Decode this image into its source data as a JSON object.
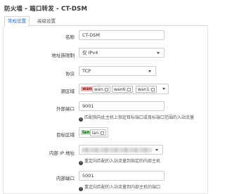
{
  "page_title": "防火墙 - 端口转发 - CT-DSM",
  "tabs": [
    {
      "label": "常规设置",
      "active": true
    },
    {
      "label": "高级设置",
      "active": false
    }
  ],
  "form": {
    "name": {
      "label": "名称",
      "value": "CT-DSM"
    },
    "address_family": {
      "label": "地址族限制",
      "value": "仅 IPv4"
    },
    "protocol": {
      "label": "协议",
      "value": "TCP"
    },
    "source_zone": {
      "label": "源区域",
      "zone": "wan",
      "devices": [
        "wan:",
        "wan6:",
        "wan1:"
      ]
    },
    "external_port": {
      "label": "外部端口",
      "value": "9001",
      "help": "匹配指向此主机上指定目标端口或目标端口范围的入站流量"
    },
    "dest_zone": {
      "label": "目标区域",
      "zone": "lan",
      "devices": [
        "lan:"
      ]
    },
    "internal_ip": {
      "label": "内部 IP 地址",
      "help": "重定向匹配的入站流量到指定的内部主机"
    },
    "internal_port": {
      "label": "内部端口",
      "value": "5001",
      "help": "重定向匹配的入站流量到内部主机的端口"
    }
  },
  "colors": {
    "accent": "#1e6fd0",
    "wan_zone": "#f5b3b3",
    "lan_zone": "#bde9bd"
  },
  "icons": {
    "info": "info-circle-icon",
    "caret": "caret-down-icon",
    "network": "network-port-icon"
  }
}
